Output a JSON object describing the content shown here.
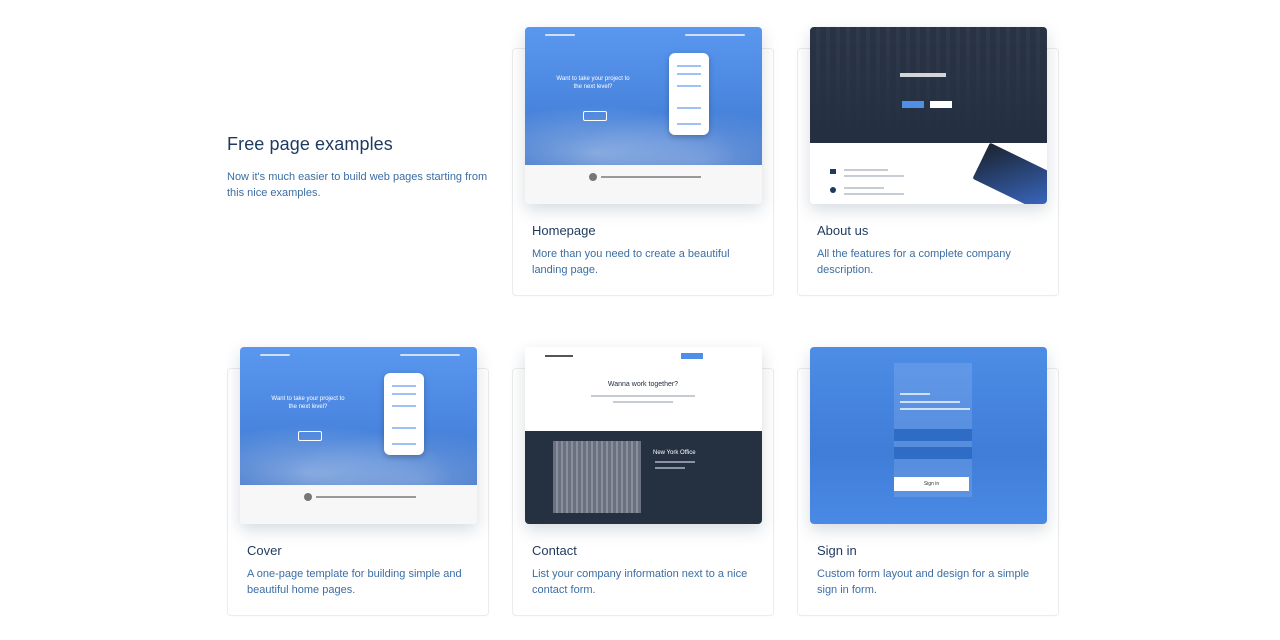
{
  "intro": {
    "title": "Free page examples",
    "subtitle": "Now it's much easier to build web pages starting from this nice examples."
  },
  "cards": [
    {
      "title": "Homepage",
      "desc": "More than you need to create a beautiful landing page.",
      "hero": "Want to take your project to the next level?"
    },
    {
      "title": "About us",
      "desc": "All the features for a complete company description."
    },
    {
      "title": "Cover",
      "desc": "A one-page template for building simple and beautiful home pages.",
      "hero": "Want to take your project to the next level?"
    },
    {
      "title": "Contact",
      "desc": "List your company information next to a nice contact form.",
      "hero": "Wanna work together?",
      "office": "New York Office"
    },
    {
      "title": "Sign in",
      "desc": "Custom form layout and design for a simple sign in form.",
      "button": "Sign in"
    }
  ]
}
